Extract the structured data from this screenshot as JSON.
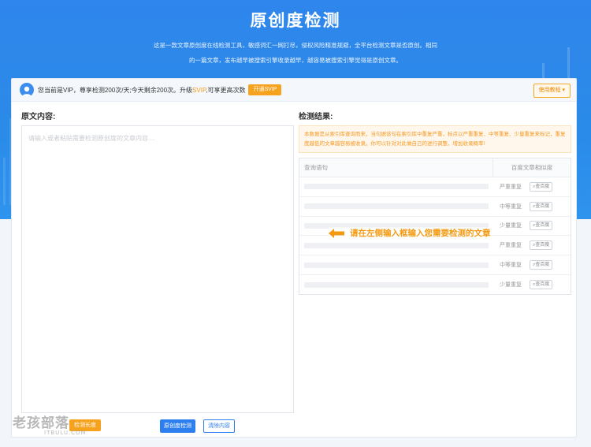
{
  "hero": {
    "title": "原创度检测",
    "desc_line1": "这是一款文章原创度在线检测工具，敏感词汇一网打尽，侵权风险精准规避，全平台检测文章是否原创。相同",
    "desc_line2": "的一篇文章，发布越早被搜索引擎收录越早，越容易被搜索引擎觉得是原创文章。"
  },
  "vip_bar": {
    "text_prefix": "您当前是VIP，尊享检测200次/天;今天剩余200次。升级",
    "svip": "SVIP",
    "text_suffix": ",可享更高次数",
    "open_button": "开通SVIP",
    "guide_button": "使用教程"
  },
  "editor": {
    "label": "原文内容:",
    "placeholder": "请输入或者粘贴需要检测原创度的文章内容...."
  },
  "results": {
    "label": "检测结果:",
    "notice": "本数据是从索引库查询而来，当句据该句在索引库中重复严重，标点以严重重复、中等重复、少量重复来标记，重复度越低的文章越容易被收录。你可以针对对此做自己的进行调整，增加收录概率!",
    "col_query": "查询语句",
    "col_similarity": "百度文章相似度",
    "rows": [
      {
        "degree": "严重重复",
        "check": "查百度"
      },
      {
        "degree": "中等重复",
        "check": "查百度"
      },
      {
        "degree": "少量重复",
        "check": "查百度"
      },
      {
        "degree": "严重重复",
        "check": "查百度"
      },
      {
        "degree": "中等重复",
        "check": "查百度"
      },
      {
        "degree": "少量重复",
        "check": "查百度"
      }
    ],
    "hint": "请在左侧输入框输入您需要检测的文章"
  },
  "actions": {
    "length_button": "检测长度",
    "detect_button": "原创度检测",
    "clear_button": "清除内容"
  },
  "watermark": {
    "line1": "老孩部落",
    "line2": "ITBULU.COM"
  },
  "colors": {
    "primary": "#2d7ff0",
    "accent": "#f7a21d"
  }
}
